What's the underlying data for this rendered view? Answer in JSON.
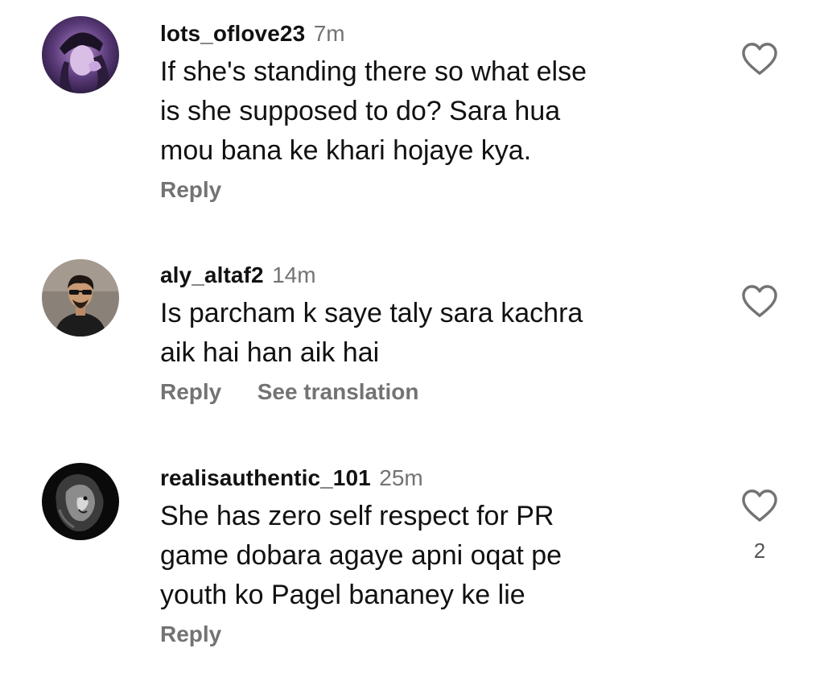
{
  "comments": [
    {
      "username": "lots_oflove23",
      "time": "7m",
      "text": "If she's standing there so what else\nis she supposed to do? Sara hua\nmou bana ke khari hojaye kya.",
      "actions": {
        "reply": "Reply"
      },
      "avatar_icon": "profile-photo-hooded-figure",
      "like_icon": "heart-outline-icon"
    },
    {
      "username": "aly_altaf2",
      "time": "14m",
      "text": "Is parcham k saye taly sara kachra\naik hai han aik hai",
      "actions": {
        "reply": "Reply",
        "translate": "See translation"
      },
      "avatar_icon": "profile-photo-man-sunglasses",
      "like_icon": "heart-outline-icon"
    },
    {
      "username": "realisauthentic_101",
      "time": "25m",
      "text": "She has zero self respect for PR\ngame dobara agaye apni oqat pe\nyouth ko Pagel bananey ke lie",
      "actions": {
        "reply": "Reply"
      },
      "like_count": "2",
      "avatar_icon": "profile-photo-lion",
      "like_icon": "heart-outline-icon"
    }
  ],
  "colors": {
    "text": "#111111",
    "secondary": "#737373",
    "background": "#ffffff"
  }
}
